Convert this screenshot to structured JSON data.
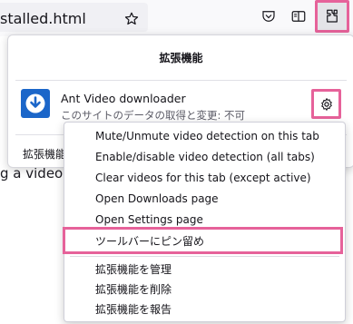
{
  "toolbar": {
    "url_fragment": "stalled.html"
  },
  "page": {
    "background_text": "g a video t"
  },
  "panel": {
    "title": "拡張機能",
    "extension": {
      "name": "Ant Video downloader",
      "permission": "このサイトのデータの取得と変更: 不可"
    },
    "footer_link": "拡張機能"
  },
  "menu": {
    "items": [
      "Mute/Unmute video detection on this tab",
      "Enable/disable video detection (all tabs)",
      "Clear videos for this tab (except active)",
      "Open Downloads page",
      "Open Settings page",
      "ツールバーにピン留め",
      "拡張機能を管理",
      "拡張機能を削除",
      "拡張機能を報告"
    ]
  },
  "colors": {
    "highlight": "#e6629a",
    "extension_icon": "#1b66c9"
  }
}
